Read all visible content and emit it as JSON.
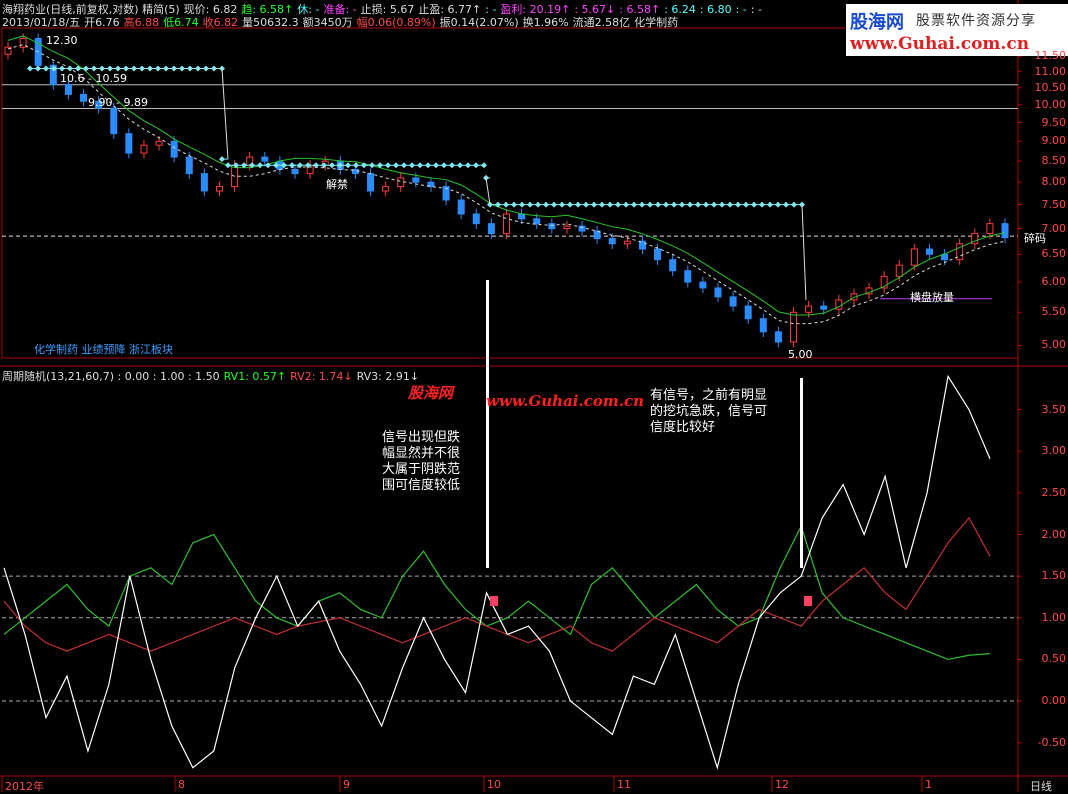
{
  "header": {
    "line1": [
      {
        "text": "海翔药业(日线,前复权,对数) 精简(5)",
        "color": "white"
      },
      {
        "text": "现价: 6.82",
        "color": "white"
      },
      {
        "text": "趋: 6.58↑",
        "color": "green"
      },
      {
        "text": "休: -",
        "color": "cyan"
      },
      {
        "text": "准备: -",
        "color": "magenta"
      },
      {
        "text": "止损: 5.67",
        "color": "white"
      },
      {
        "text": "止盈: 6.77↑",
        "color": "white"
      },
      {
        "text": ": -",
        "color": "cyan"
      },
      {
        "text": "盈利: 20.19↑",
        "color": "magenta"
      },
      {
        "text": ": 5.67↓",
        "color": "magenta"
      },
      {
        "text": ": 6.58↑",
        "color": "magenta"
      },
      {
        "text": ": 6.24",
        "color": "cyan"
      },
      {
        "text": ": 6.80",
        "color": "cyan"
      },
      {
        "text": ": -",
        "color": "cyan"
      },
      {
        "text": ": -",
        "color": "white"
      }
    ],
    "line2": [
      {
        "text": "2013/01/18/五",
        "color": "white"
      },
      {
        "text": "开6.76",
        "color": "white"
      },
      {
        "text": "高6.88",
        "color": "red"
      },
      {
        "text": "低6.74",
        "color": "green"
      },
      {
        "text": "收6.82",
        "color": "red"
      },
      {
        "text": "量50632.3",
        "color": "white"
      },
      {
        "text": "额3450万",
        "color": "white"
      },
      {
        "text": "幅0.06(0.89%)",
        "color": "red"
      },
      {
        "text": "振0.14(2.07%)",
        "color": "white"
      },
      {
        "text": "换1.96%",
        "color": "white"
      },
      {
        "text": "流通2.58亿",
        "color": "white"
      },
      {
        "text": "化学制药",
        "color": "white"
      }
    ]
  },
  "logo": {
    "brand": "股海网",
    "tagline": "股票软件资源分享",
    "url": "www.Guhai.com.cn"
  },
  "sector_text": "化学制药 业绩预降 浙江板块",
  "price_annotations": {
    "peak": "12.30",
    "level1": "10.6 - 10.59",
    "level2": "9.90 - 9.89",
    "unlock": "解禁",
    "low": "5.00",
    "sideways": "横盘放量",
    "broken": "碎码"
  },
  "indicator_header": [
    {
      "text": "周期随机(13,21,60,7) : 0.00 : 1.00 : 1.50",
      "color": "white"
    },
    {
      "text": "RV1: 0.57↑",
      "color": "green"
    },
    {
      "text": "RV2: 1.74↓",
      "color": "red"
    },
    {
      "text": "RV3: 2.91↓",
      "color": "white"
    }
  ],
  "watermark": {
    "brand": "股海网",
    "url": "www.Guhai.com.cn"
  },
  "notes": {
    "left": [
      "信号出现但跌",
      "幅显然并不很",
      "大属于阴跌范",
      "围可信度较低"
    ],
    "right": [
      "有信号，之前有明显",
      "的挖坑急跌，信号可",
      "信度比较好"
    ]
  },
  "price_axis": [
    "11.50",
    "11.00",
    "10.50",
    "10.00",
    "9.50",
    "9.00",
    "8.50",
    "8.00",
    "7.50",
    "7.00",
    "6.50",
    "6.00",
    "5.50",
    "5.00"
  ],
  "indicator_axis": [
    "3.50",
    "3.00",
    "2.50",
    "2.00",
    "1.50",
    "1.00",
    "0.50",
    "0.00",
    "-0.50"
  ],
  "time_axis": [
    {
      "label": "2012年"
    },
    {
      "label": "8"
    },
    {
      "label": "9"
    },
    {
      "label": "10"
    },
    {
      "label": "11"
    },
    {
      "label": "12"
    },
    {
      "label": "1"
    }
  ],
  "period_label": "日线",
  "colors": {
    "up": "#ff3b3b",
    "down": "#2a8cff",
    "axis": "#b00000",
    "ma": "#27c427",
    "rv1": "#2fbf2f",
    "rv2": "#c43030",
    "rv3": "#ffffff",
    "stop": "#7ee8f0"
  },
  "chart_data": {
    "type": "line",
    "price": {
      "scale": "log",
      "ylim": [
        4.85,
        12.4
      ],
      "close_series": [
        11.8,
        12.1,
        11.2,
        10.6,
        10.3,
        10.1,
        9.9,
        9.2,
        8.7,
        8.9,
        9.0,
        8.6,
        8.2,
        7.8,
        7.9,
        8.4,
        8.6,
        8.5,
        8.3,
        8.2,
        8.4,
        8.5,
        8.3,
        8.2,
        7.8,
        7.9,
        8.1,
        8.0,
        7.9,
        7.6,
        7.3,
        7.1,
        6.9,
        7.3,
        7.2,
        7.1,
        7.0,
        7.05,
        6.95,
        6.8,
        6.7,
        6.75,
        6.6,
        6.4,
        6.2,
        6.0,
        5.9,
        5.75,
        5.6,
        5.4,
        5.2,
        5.05,
        5.5,
        5.6,
        5.55,
        5.7,
        5.8,
        5.9,
        6.1,
        6.3,
        6.6,
        6.5,
        6.4,
        6.7,
        6.9,
        7.1,
        6.82
      ],
      "stop_levels": [
        11.0,
        11.0,
        11.0,
        11.0,
        11.0,
        8.5,
        8.4,
        8.1,
        7.5,
        7.5,
        7.5,
        7.5,
        7.5,
        7.5
      ]
    },
    "indicator": {
      "ylim": [
        -0.9,
        4.0
      ],
      "reference_lines": [
        0.0,
        1.0,
        1.5
      ],
      "series": [
        {
          "name": "RV1",
          "values": [
            0.8,
            1.0,
            1.2,
            1.4,
            1.1,
            0.9,
            1.5,
            1.6,
            1.4,
            1.9,
            2.0,
            1.6,
            1.2,
            1.0,
            0.9,
            1.2,
            1.3,
            1.1,
            1.0,
            1.5,
            1.8,
            1.4,
            1.1,
            0.9,
            1.0,
            1.2,
            1.0,
            0.8,
            1.4,
            1.6,
            1.3,
            1.0,
            1.2,
            1.4,
            1.1,
            0.9,
            1.0,
            1.6,
            2.1,
            1.3,
            1.0,
            0.9,
            0.8,
            0.7,
            0.6,
            0.5,
            0.55,
            0.57
          ]
        },
        {
          "name": "RV2",
          "values": [
            1.2,
            0.9,
            0.7,
            0.6,
            0.7,
            0.8,
            0.7,
            0.6,
            0.7,
            0.8,
            0.9,
            1.0,
            0.9,
            0.8,
            0.9,
            0.95,
            1.0,
            0.9,
            0.8,
            0.7,
            0.8,
            0.9,
            1.0,
            0.9,
            0.8,
            0.7,
            0.8,
            0.9,
            0.7,
            0.6,
            0.8,
            1.0,
            0.9,
            0.8,
            0.7,
            0.9,
            1.1,
            1.0,
            0.9,
            1.2,
            1.4,
            1.6,
            1.3,
            1.1,
            1.5,
            1.9,
            2.2,
            1.74
          ]
        },
        {
          "name": "RV3",
          "values": [
            1.6,
            0.8,
            -0.2,
            0.3,
            -0.6,
            0.2,
            1.5,
            0.5,
            -0.3,
            -0.8,
            -0.6,
            0.4,
            1.0,
            1.5,
            0.9,
            1.2,
            0.6,
            0.2,
            -0.3,
            0.4,
            1.0,
            0.5,
            0.1,
            1.3,
            0.8,
            0.9,
            0.6,
            0.0,
            -0.2,
            -0.4,
            0.3,
            0.2,
            0.8,
            0.0,
            -0.8,
            0.2,
            1.0,
            1.3,
            1.5,
            2.2,
            2.6,
            2.0,
            2.7,
            1.6,
            2.5,
            3.9,
            3.5,
            2.91
          ]
        }
      ]
    }
  }
}
